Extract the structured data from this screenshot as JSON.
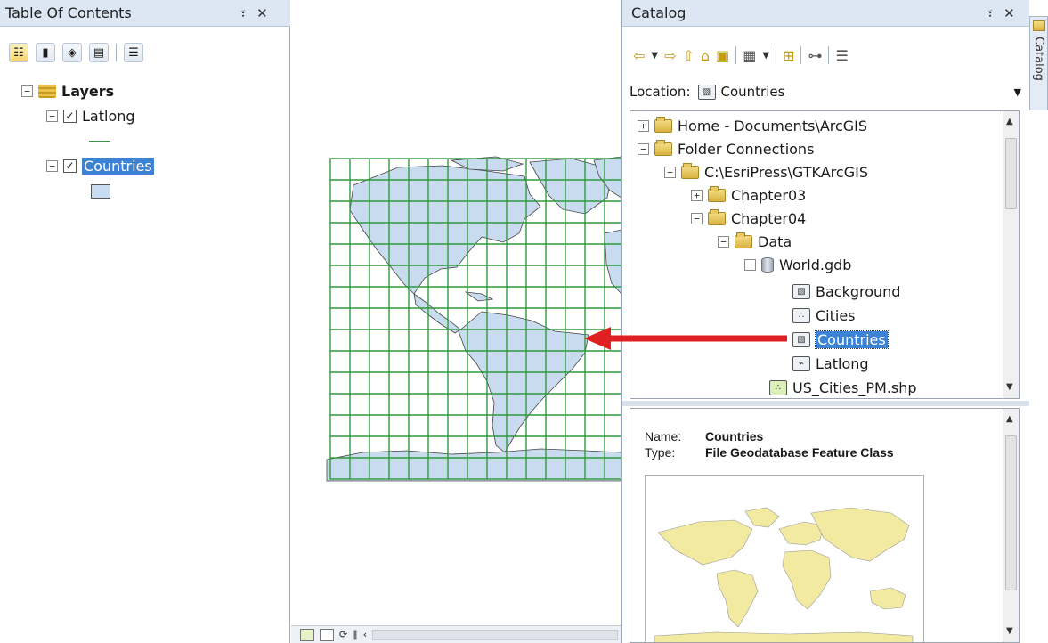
{
  "toc": {
    "title": "Table Of Contents",
    "pin_glyph": "፣",
    "close_glyph": "✕",
    "toolbar_icons": [
      "list-by-drawing-order-icon",
      "list-by-source-icon",
      "list-by-visibility-icon",
      "list-by-selection-icon",
      "options-icon"
    ],
    "layers_label": "Layers",
    "items": [
      {
        "label": "Latlong",
        "checked": "✓"
      },
      {
        "label": "Countries",
        "checked": "✓"
      }
    ]
  },
  "map": {
    "land_color": "#c9dcef",
    "grid_color": "#2e9a3c",
    "bottom_icons": [
      "data-view-icon",
      "layout-view-icon",
      "refresh-icon",
      "pause-icon",
      "scroll-left-icon"
    ]
  },
  "catalog": {
    "title": "Catalog",
    "pin_glyph": "፣",
    "close_glyph": "✕",
    "side_tab_label": "Catalog",
    "location_label": "Location:",
    "location_value": "Countries",
    "toolbar_icons": [
      "back-icon",
      "back-dropdown-icon",
      "forward-icon",
      "up-one-level-icon",
      "home-folder-icon",
      "connect-folder-icon",
      "view-options-icon",
      "view-dropdown-icon",
      "new-item-icon",
      "show-tree-icon",
      "options-icon"
    ],
    "tree": [
      {
        "label": "Home - Documents\\ArcGIS",
        "expander": "+"
      },
      {
        "label": "Folder Connections",
        "expander": "−"
      },
      {
        "label": "C:\\EsriPress\\GTKArcGIS",
        "expander": "−"
      },
      {
        "label": "Chapter03",
        "expander": "+"
      },
      {
        "label": "Chapter04",
        "expander": "−"
      },
      {
        "label": "Data",
        "expander": "−"
      },
      {
        "label": "World.gdb",
        "expander": "−"
      },
      {
        "label": "Background",
        "expander": ""
      },
      {
        "label": "Cities",
        "expander": ""
      },
      {
        "label": "Countries",
        "expander": ""
      },
      {
        "label": "Latlong",
        "expander": ""
      },
      {
        "label": "US_Cities_PM.shp",
        "expander": ""
      }
    ],
    "preview": {
      "name_label": "Name:",
      "name_value": "Countries",
      "type_label": "Type:",
      "type_value": "File Geodatabase Feature Class"
    }
  },
  "annotation": {
    "arrow_color": "#e02020"
  }
}
